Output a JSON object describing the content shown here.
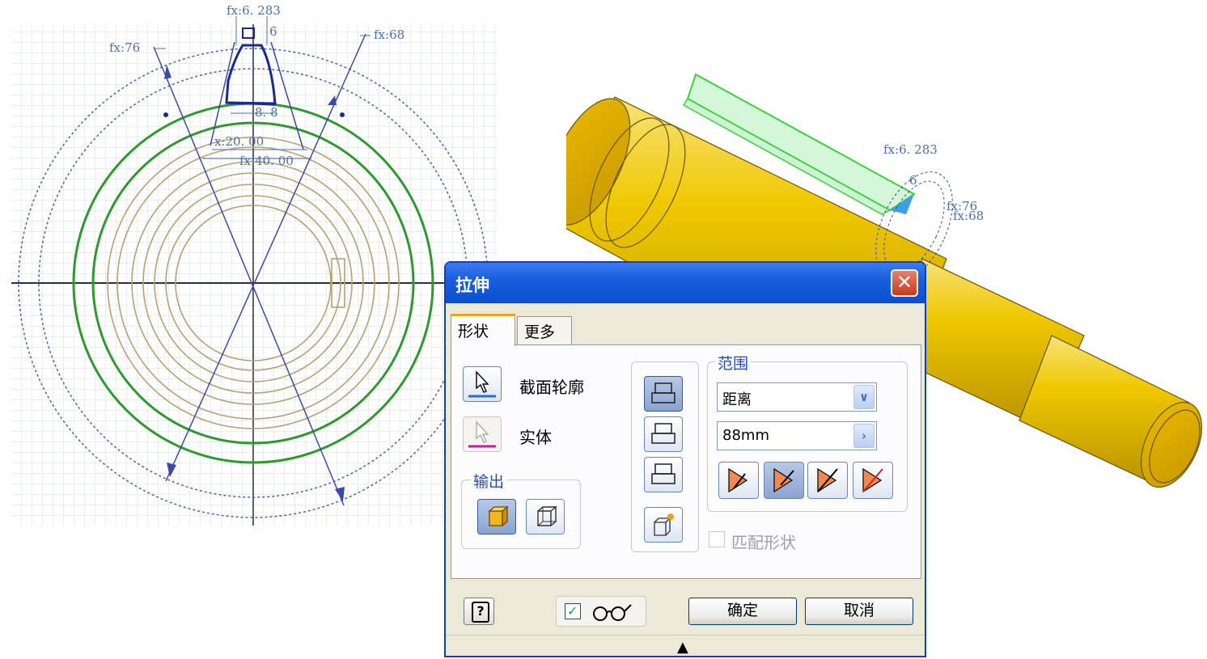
{
  "sketch": {
    "dimensions": {
      "fx_283": "fx:6. 283",
      "fx_76": "fx:76",
      "fx_68": "fx:68",
      "d_6": "6",
      "d_88": "8. 8",
      "x_20": "x:20. 00",
      "fx_40": "fx:40. 00"
    }
  },
  "model": {
    "labels": {
      "fx_283": "fx:6. 283",
      "fx_76": "fx:76",
      "fx_68": "fx:68",
      "d_6": "6"
    }
  },
  "dialog": {
    "title": "拉伸",
    "close_glyph": "✕",
    "tabs": [
      {
        "label": "形状"
      },
      {
        "label": "更多"
      }
    ],
    "profile_label": "截面轮廓",
    "solid_label": "实体",
    "output_group_label": "输出",
    "extents": {
      "group_label": "范围",
      "type_value": "距离",
      "distance_value": "88mm"
    },
    "match_shape_label": "匹配形状",
    "ok_label": "确定",
    "cancel_label": "取消",
    "help_glyph": "?",
    "expand_glyph": "▲",
    "checkmark_glyph": "✓",
    "colors": {
      "title_blue": "#0a4fd0",
      "model_yellow": "#f0c800",
      "sketch_green": "#2e9a2e",
      "sketch_tan": "#b8a070"
    }
  }
}
